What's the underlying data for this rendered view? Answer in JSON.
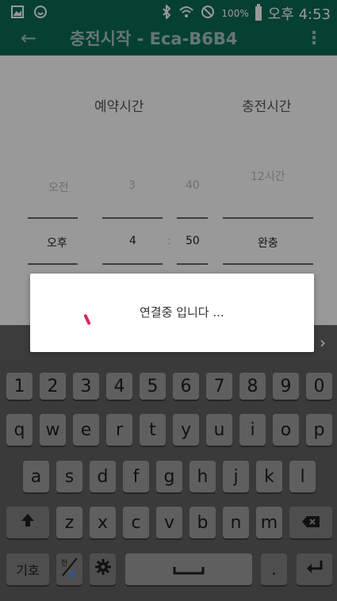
{
  "status_bar": {
    "battery_percent": "100%",
    "time": "오후 4:53"
  },
  "app_bar": {
    "title": "충전시작 - Eca-B6B4"
  },
  "schedule": {
    "reserve_label": "예약시간",
    "charge_label": "충전시간",
    "faint_ampm": "오전",
    "faint_hour": "3",
    "faint_minute": "40",
    "faint_duration": "12시간",
    "selected_ampm": "오후",
    "selected_hour": "4",
    "separator": ":",
    "selected_minute": "50",
    "selected_duration": "완충"
  },
  "dialog": {
    "message": "연결중 입니다 ..."
  },
  "keyboard": {
    "row_numbers": [
      "1",
      "2",
      "3",
      "4",
      "5",
      "6",
      "7",
      "8",
      "9",
      "0"
    ],
    "row1": [
      "q",
      "w",
      "e",
      "r",
      "t",
      "y",
      "u",
      "i",
      "o",
      "p"
    ],
    "row2": [
      "a",
      "s",
      "d",
      "f",
      "g",
      "h",
      "j",
      "k",
      "l"
    ],
    "row3": [
      "z",
      "x",
      "c",
      "v",
      "b",
      "n",
      "m"
    ],
    "symbols_label": "기호",
    "period": "."
  }
}
